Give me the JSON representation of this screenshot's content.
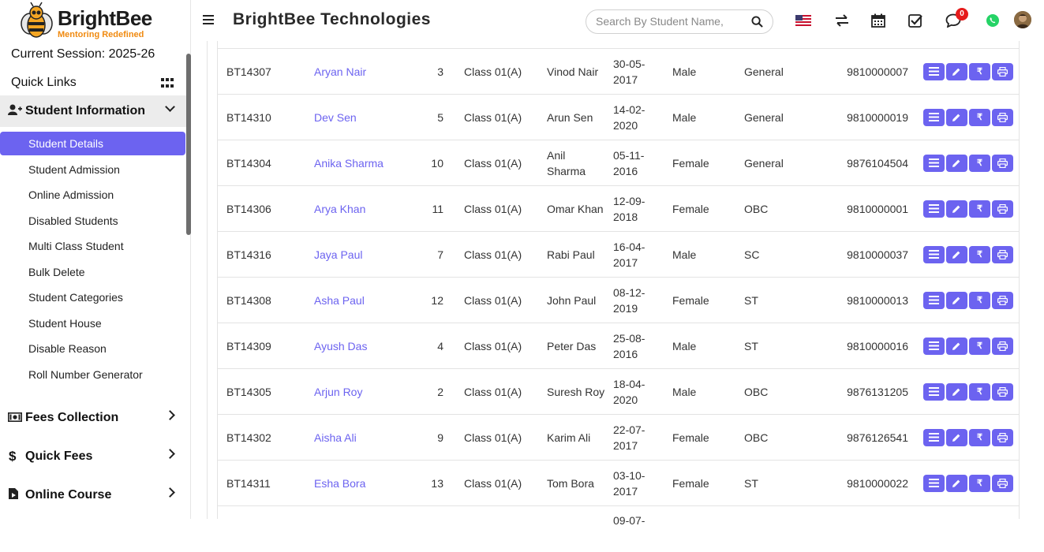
{
  "brand": {
    "logo_name": "BrightBee",
    "logo_tagline": "Mentoring Redefined",
    "title": "BrightBee Technologies"
  },
  "sidebar": {
    "session": "Current Session: 2025-26",
    "quick_links": "Quick Links",
    "sections": [
      {
        "label": "Student Information",
        "icon": "user-plus-icon",
        "expanded": true
      },
      {
        "label": "Fees Collection",
        "icon": "money-icon",
        "expanded": false
      },
      {
        "label": "Quick Fees",
        "icon": "dollar-icon",
        "expanded": false
      },
      {
        "label": "Online Course",
        "icon": "video-icon",
        "expanded": false
      }
    ],
    "sub_items": [
      {
        "label": "Student Details",
        "active": true
      },
      {
        "label": "Student Admission"
      },
      {
        "label": "Online Admission"
      },
      {
        "label": "Disabled Students"
      },
      {
        "label": "Multi Class Student"
      },
      {
        "label": "Bulk Delete"
      },
      {
        "label": "Student Categories"
      },
      {
        "label": "Student House"
      },
      {
        "label": "Disable Reason"
      },
      {
        "label": "Roll Number Generator"
      }
    ]
  },
  "search": {
    "placeholder": "Search By Student Name,"
  },
  "header_icons": {
    "notification_count": "0"
  },
  "colors": {
    "accent": "#6c63f0",
    "badge": "#e61b1b",
    "whatsapp": "#25d366"
  },
  "students": [
    {
      "admission_no": "BT14307",
      "name": "Aryan Nair",
      "roll": "3",
      "class": "Class 01(A)",
      "father": "Vinod Nair",
      "dob": "30-05-2017",
      "gender": "Male",
      "category": "General",
      "phone": "9810000007"
    },
    {
      "admission_no": "BT14310",
      "name": "Dev Sen",
      "roll": "5",
      "class": "Class 01(A)",
      "father": "Arun Sen",
      "dob": "14-02-2020",
      "gender": "Male",
      "category": "General",
      "phone": "9810000019"
    },
    {
      "admission_no": "BT14304",
      "name": "Anika Sharma",
      "roll": "10",
      "class": "Class 01(A)",
      "father": "Anil Sharma",
      "dob": "05-11-2016",
      "gender": "Female",
      "category": "General",
      "phone": "9876104504"
    },
    {
      "admission_no": "BT14306",
      "name": "Arya Khan",
      "roll": "11",
      "class": "Class 01(A)",
      "father": "Omar Khan",
      "dob": "12-09-2018",
      "gender": "Female",
      "category": "OBC",
      "phone": "9810000001"
    },
    {
      "admission_no": "BT14316",
      "name": "Jaya Paul",
      "roll": "7",
      "class": "Class 01(A)",
      "father": "Rabi Paul",
      "dob": "16-04-2017",
      "gender": "Male",
      "category": "SC",
      "phone": "9810000037"
    },
    {
      "admission_no": "BT14308",
      "name": "Asha Paul",
      "roll": "12",
      "class": "Class 01(A)",
      "father": "John Paul",
      "dob": "08-12-2019",
      "gender": "Female",
      "category": "ST",
      "phone": "9810000013"
    },
    {
      "admission_no": "BT14309",
      "name": "Ayush Das",
      "roll": "4",
      "class": "Class 01(A)",
      "father": "Peter Das",
      "dob": "25-08-2016",
      "gender": "Male",
      "category": "ST",
      "phone": "9810000016"
    },
    {
      "admission_no": "BT14305",
      "name": "Arjun Roy",
      "roll": "2",
      "class": "Class 01(A)",
      "father": "Suresh Roy",
      "dob": "18-04-2020",
      "gender": "Male",
      "category": "OBC",
      "phone": "9876131205"
    },
    {
      "admission_no": "BT14302",
      "name": "Aisha Ali",
      "roll": "9",
      "class": "Class 01(A)",
      "father": "Karim Ali",
      "dob": "22-07-2017",
      "gender": "Female",
      "category": "OBC",
      "phone": "9876126541"
    },
    {
      "admission_no": "BT14311",
      "name": "Esha Bora",
      "roll": "13",
      "class": "Class 01(A)",
      "father": "Tom Bora",
      "dob": "03-10-2017",
      "gender": "Female",
      "category": "ST",
      "phone": "9810000022"
    }
  ],
  "partial_row": {
    "dob": "09-07-"
  },
  "row_actions": [
    "list-icon",
    "edit-icon",
    "rupee-icon",
    "print-icon"
  ],
  "rupee_symbol": "₹"
}
